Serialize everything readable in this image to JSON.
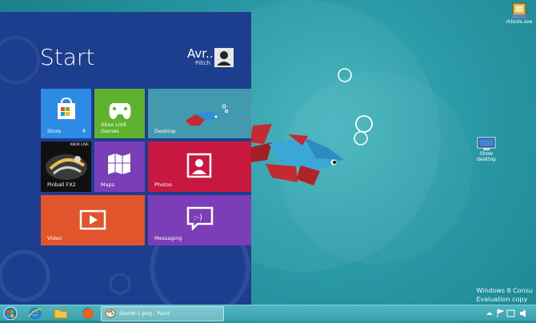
{
  "start": {
    "title": "Start",
    "user": {
      "name": "Avr...",
      "sub": "Piltch"
    },
    "tiles": {
      "store": {
        "label": "Store",
        "badge": "4"
      },
      "xbox": {
        "label": "Xbox LIVE Games"
      },
      "desktop": {
        "label": "Desktop"
      },
      "pinball": {
        "label": "Pinball FX2",
        "badge_text": "XBOX LIVE"
      },
      "maps": {
        "label": "Maps"
      },
      "photos": {
        "label": "Photos"
      },
      "video": {
        "label": "Video"
      },
      "messaging": {
        "label": "Messaging"
      }
    }
  },
  "desktop": {
    "icons": [
      {
        "label": "rktools.exe"
      },
      {
        "label": "Show desktop"
      }
    ],
    "watermark": [
      "Windows 8 Consu",
      "Evaluation copy"
    ]
  },
  "taskbar": {
    "active_window": "Start8-1.png - Paint"
  }
}
